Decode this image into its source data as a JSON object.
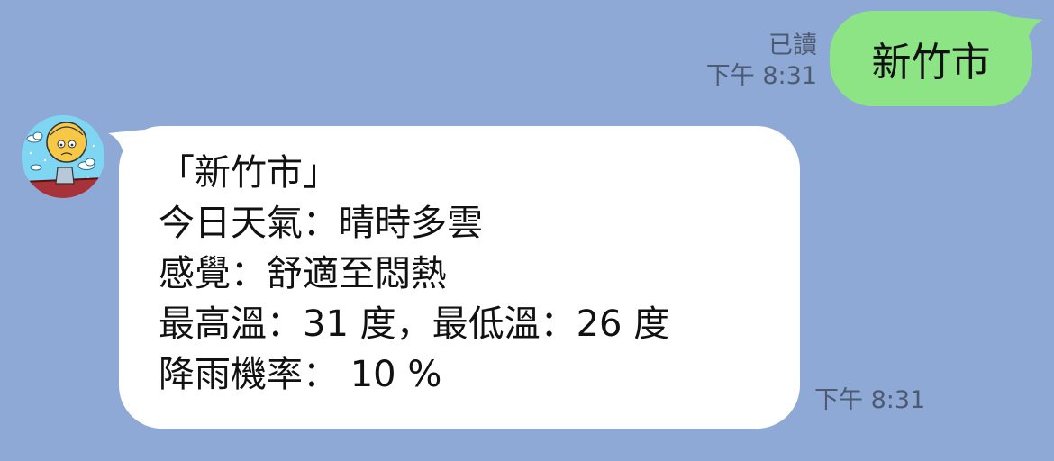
{
  "outgoing": {
    "text": "新竹市",
    "read_status": "已讀",
    "time": "下午 8:31",
    "bubble_color": "#8de485"
  },
  "incoming": {
    "lines": [
      "「新竹市」",
      "今日天氣：晴時多雲",
      "感覺：舒適至悶熱",
      "最高溫：31 度，最低溫：26 度",
      "降雨機率： 10 %"
    ],
    "time": "下午 8:31",
    "bubble_color": "#ffffff"
  },
  "avatar": {
    "icon": "sun-character-avatar-icon"
  },
  "colors": {
    "background": "#8fa9d6",
    "meta_text": "#4d5a70"
  }
}
